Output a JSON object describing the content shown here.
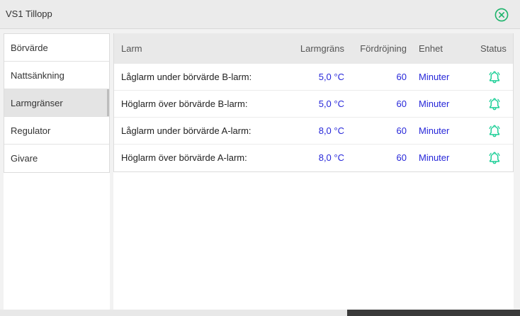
{
  "window": {
    "title": "VS1 Tillopp"
  },
  "sidebar": {
    "items": [
      {
        "label": "Börvärde",
        "active": false
      },
      {
        "label": "Nattsänkning",
        "active": false
      },
      {
        "label": "Larmgränser",
        "active": true
      },
      {
        "label": "Regulator",
        "active": false
      },
      {
        "label": "Givare",
        "active": false
      }
    ]
  },
  "table": {
    "headers": {
      "alarm": "Larm",
      "limit": "Larmgräns",
      "delay": "Fördröjning",
      "unit": "Enhet",
      "status": "Status"
    },
    "rows": [
      {
        "alarm": "Låglarm under börvärde B-larm:",
        "limit": "5,0 °C",
        "delay": "60",
        "unit": "Minuter",
        "status_icon": "bell-icon"
      },
      {
        "alarm": "Höglarm över börvärde B-larm:",
        "limit": "5,0 °C",
        "delay": "60",
        "unit": "Minuter",
        "status_icon": "bell-icon"
      },
      {
        "alarm": "Låglarm under börvärde A-larm:",
        "limit": "8,0 °C",
        "delay": "60",
        "unit": "Minuter",
        "status_icon": "bell-icon"
      },
      {
        "alarm": "Höglarm över börvärde A-larm:",
        "limit": "8,0 °C",
        "delay": "60",
        "unit": "Minuter",
        "status_icon": "bell-icon"
      }
    ]
  },
  "colors": {
    "accent_green": "#1bb36a",
    "bell_green": "#1fcf98",
    "value_blue": "#2626d9"
  }
}
